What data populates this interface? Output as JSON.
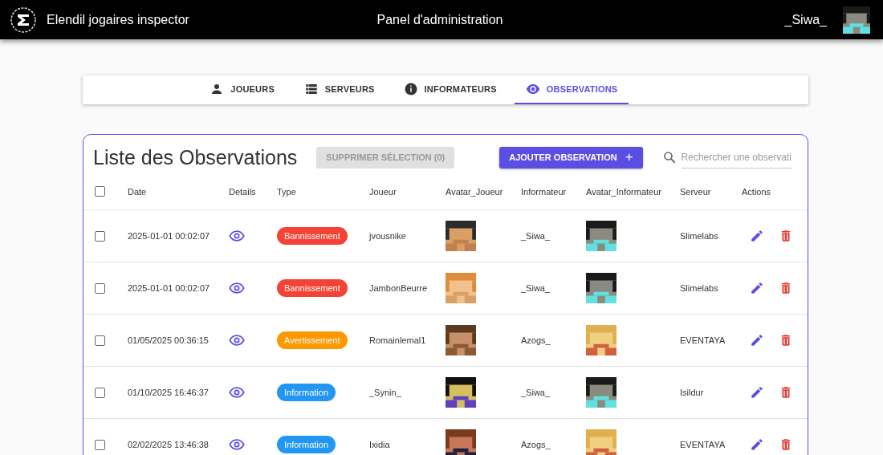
{
  "app_bar": {
    "title": "Elendil jogaires inspector",
    "page_title": "Panel d'administration",
    "username": "_Siwa_"
  },
  "tabs": [
    {
      "label": "JOUEURS",
      "selected": false
    },
    {
      "label": "SERVEURS",
      "selected": false
    },
    {
      "label": "INFORMATEURS",
      "selected": false
    },
    {
      "label": "OBSERVATIONS",
      "selected": true
    }
  ],
  "panel": {
    "title": "Liste des Observations",
    "delete_button": {
      "label": "SUPPRIMER SÉLECTION (0)",
      "disabled": true
    },
    "add_button": {
      "label": "AJOUTER OBSERVATION",
      "icon": "+"
    },
    "search": {
      "placeholder": "Rechercher une observati"
    }
  },
  "table": {
    "select_all": {
      "checked": false
    },
    "columns": [
      "Date",
      "Details",
      "Type",
      "Joueur",
      "Avatar_Joueur",
      "Informateur",
      "Avatar_Informateur",
      "Serveur",
      "Actions"
    ],
    "rows": [
      {
        "checked": false,
        "date": "2025-01-01 00:02:07",
        "type": {
          "label": "Bannissement",
          "color": "#f44336"
        },
        "joueur": "jvousnike",
        "informateur": "_Siwa_",
        "serveur": "Slimelabs"
      },
      {
        "checked": false,
        "date": "2025-01-01 00:02:07",
        "type": {
          "label": "Bannissement",
          "color": "#f44336"
        },
        "joueur": "JambonBeurre",
        "informateur": "_Siwa_",
        "serveur": "Slimelabs"
      },
      {
        "checked": false,
        "date": "01/05/2025 00:36:15",
        "type": {
          "label": "Avertissement",
          "color": "#ff9800"
        },
        "joueur": "Romainlemal1",
        "informateur": "Azogs_",
        "serveur": "EVENTAYA"
      },
      {
        "checked": false,
        "date": "01/10/2025 16:46:37",
        "type": {
          "label": "Information",
          "color": "#2196f3"
        },
        "joueur": "_Synin_",
        "informateur": "_Siwa_",
        "serveur": "Isildur"
      },
      {
        "checked": false,
        "date": "02/02/2025 13:46:38",
        "type": {
          "label": "Information",
          "color": "#2196f3"
        },
        "joueur": "Ixidia",
        "informateur": "Azogs_",
        "serveur": "EVENTAYA"
      }
    ]
  }
}
